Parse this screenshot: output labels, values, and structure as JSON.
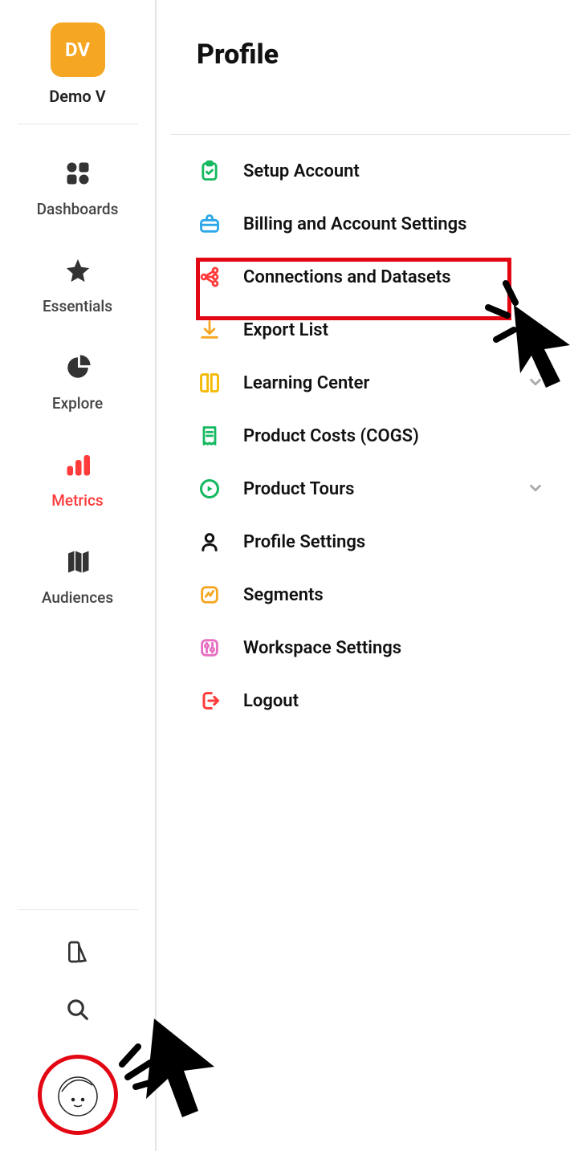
{
  "user": {
    "initials": "DV",
    "name": "Demo V"
  },
  "sidebar": {
    "items": [
      {
        "id": "dashboards",
        "label": "Dashboards",
        "active": false
      },
      {
        "id": "essentials",
        "label": "Essentials",
        "active": false
      },
      {
        "id": "explore",
        "label": "Explore",
        "active": false
      },
      {
        "id": "metrics",
        "label": "Metrics",
        "active": true
      },
      {
        "id": "audiences",
        "label": "Audiences",
        "active": false
      }
    ]
  },
  "page": {
    "title": "Profile"
  },
  "menu": {
    "items": [
      {
        "id": "setup-account",
        "label": "Setup Account"
      },
      {
        "id": "billing",
        "label": "Billing and Account Settings"
      },
      {
        "id": "connections",
        "label": "Connections and Datasets"
      },
      {
        "id": "export-list",
        "label": "Export List"
      },
      {
        "id": "learning-center",
        "label": "Learning Center",
        "has_submenu": true
      },
      {
        "id": "product-costs",
        "label": "Product Costs (COGS)"
      },
      {
        "id": "product-tours",
        "label": "Product Tours",
        "has_submenu": true
      },
      {
        "id": "profile-settings",
        "label": "Profile Settings"
      },
      {
        "id": "segments",
        "label": "Segments"
      },
      {
        "id": "workspace",
        "label": "Workspace Settings"
      },
      {
        "id": "logout",
        "label": "Logout"
      }
    ]
  },
  "annotations": {
    "highlight_menu_item_id": "connections",
    "cursor_near_highlight": true,
    "cursor_near_profile_avatar": true
  },
  "colors": {
    "accent_orange": "#f5a623",
    "accent_red": "#ff3b3b",
    "annotation_red": "#e30613"
  }
}
